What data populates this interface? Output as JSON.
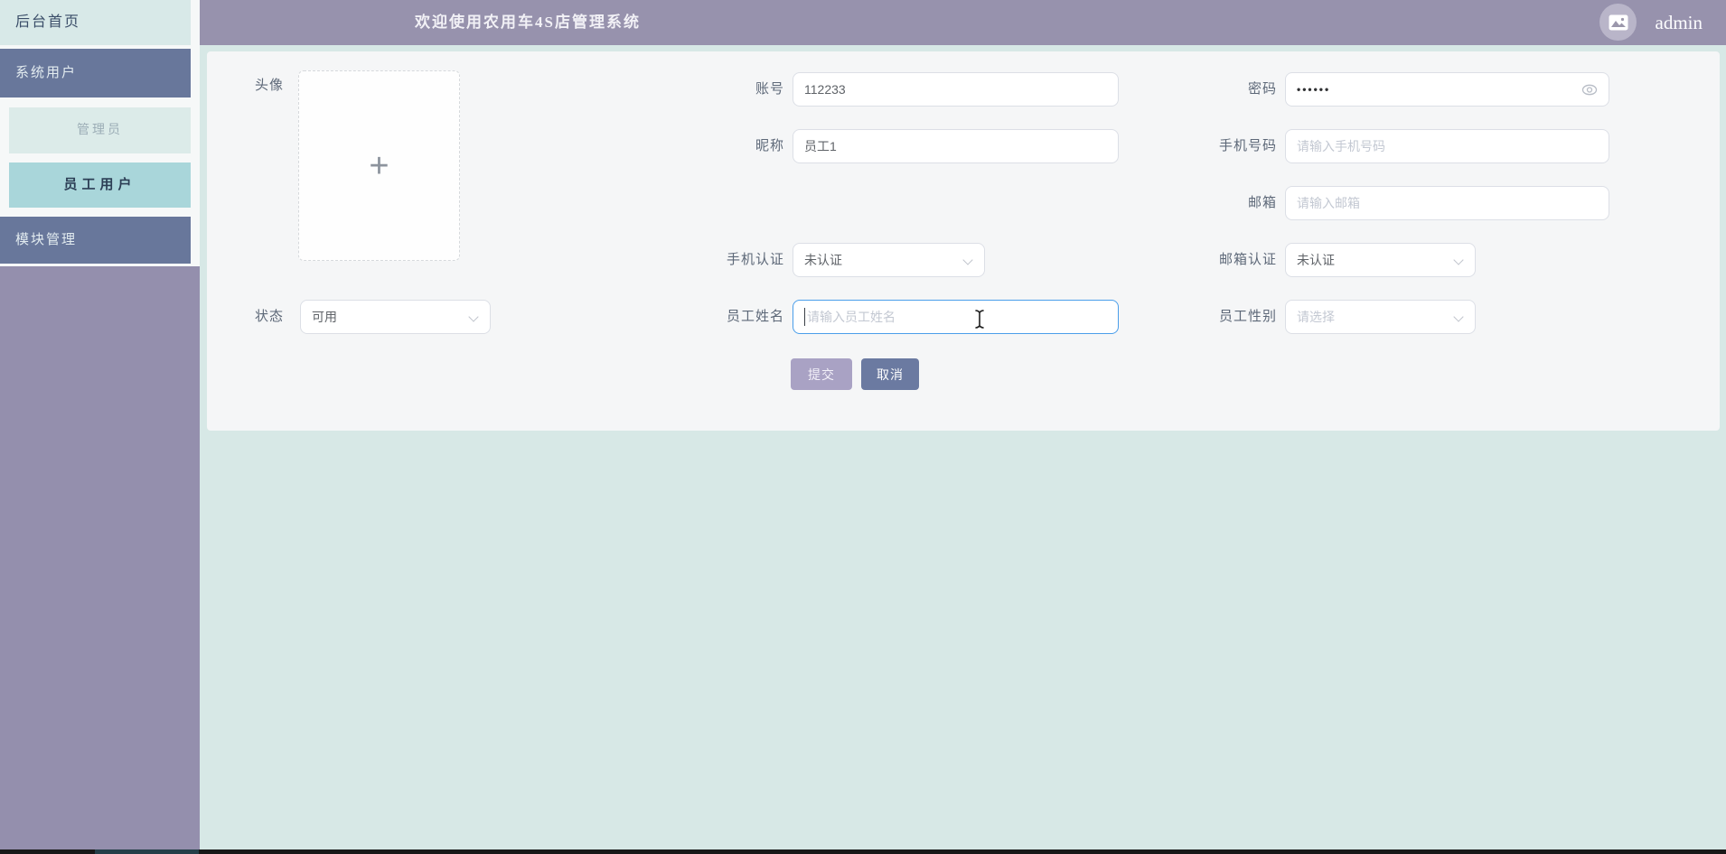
{
  "header": {
    "title": "欢迎使用农用车4S店管理系统",
    "user": "admin"
  },
  "sidebar": {
    "items": [
      {
        "label": "后台首页"
      },
      {
        "label": "系统用户"
      },
      {
        "label": "管理员"
      },
      {
        "label": "员工用户"
      },
      {
        "label": "模块管理"
      }
    ]
  },
  "form": {
    "avatar": {
      "label": "头像"
    },
    "account": {
      "label": "账号",
      "value": "112233"
    },
    "password": {
      "label": "密码",
      "value": "••••••"
    },
    "nickname": {
      "label": "昵称",
      "value": "员工1"
    },
    "phone": {
      "label": "手机号码",
      "placeholder": "请输入手机号码"
    },
    "email": {
      "label": "邮箱",
      "placeholder": "请输入邮箱"
    },
    "phone_verify": {
      "label": "手机认证",
      "value": "未认证"
    },
    "email_verify": {
      "label": "邮箱认证",
      "value": "未认证"
    },
    "status": {
      "label": "状态",
      "value": "可用"
    },
    "staff_name": {
      "label": "员工姓名",
      "placeholder": "请输入员工姓名"
    },
    "staff_gender": {
      "label": "员工性别",
      "placeholder": "请选择"
    },
    "buttons": {
      "submit": "提交",
      "cancel": "取消"
    }
  },
  "icons": {
    "user_image_icon": "image-icon",
    "password_eye": "eye-icon",
    "select_arrow": "chevron-down-icon",
    "avatar_plus": "plus-icon",
    "mouse": "ibeam-cursor"
  },
  "colors": {
    "header_bg": "#9792ad",
    "sidebar_active_bg": "#a9d6da",
    "sidebar_menu_bg": "#68779b",
    "sidebar_filler_bg": "#948fad",
    "main_bg": "#d7e8e6",
    "panel_bg": "#f5f6f7",
    "focus_border": "#4a9eea",
    "submit_bg": "#a9a2c4",
    "cancel_bg": "#6b7aa1"
  }
}
